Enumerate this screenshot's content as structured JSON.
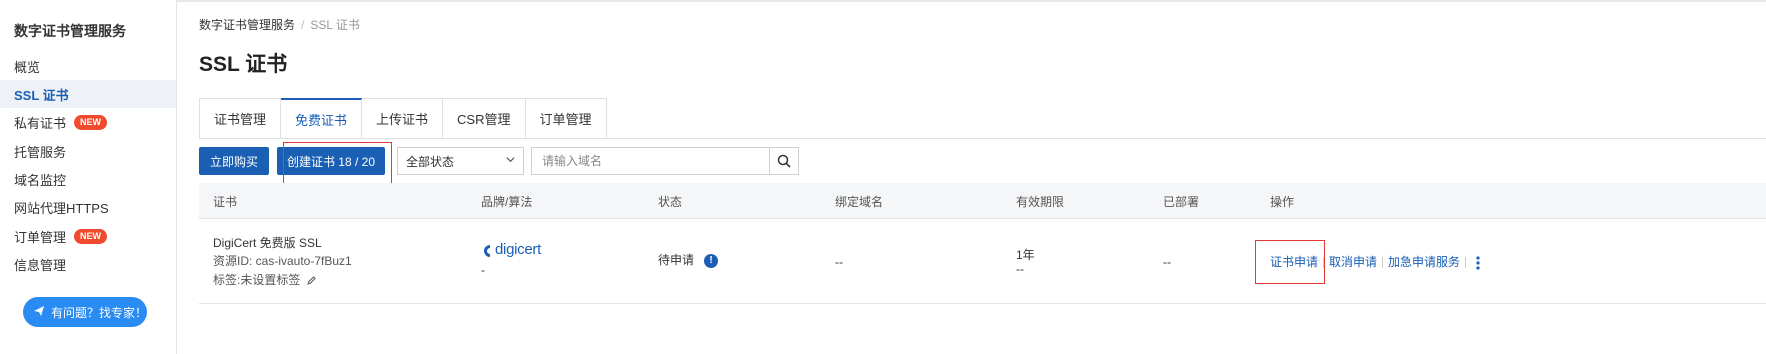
{
  "sidebar": {
    "title": "数字证书管理服务",
    "items": [
      {
        "label": "概览"
      },
      {
        "label": "SSL 证书",
        "active": true
      },
      {
        "label": "私有证书",
        "badge": "NEW"
      },
      {
        "label": "托管服务"
      },
      {
        "label": "域名监控"
      },
      {
        "label": "网站代理HTTPS"
      },
      {
        "label": "订单管理",
        "badge": "NEW"
      },
      {
        "label": "信息管理"
      }
    ],
    "help_button": "有问题？找专家！"
  },
  "breadcrumb": {
    "root": "数字证书管理服务",
    "separator": "/",
    "current": "SSL 证书"
  },
  "page_title": "SSL 证书",
  "tabs": [
    {
      "label": "证书管理"
    },
    {
      "label": "免费证书",
      "active": true
    },
    {
      "label": "上传证书"
    },
    {
      "label": "CSR管理"
    },
    {
      "label": "订单管理"
    }
  ],
  "toolbar": {
    "buy_label": "立即购买",
    "create_label": "创建证书 18 / 20",
    "status_select": "全部状态",
    "search_placeholder": "请输入域名"
  },
  "table": {
    "headers": [
      "证书",
      "品牌/算法",
      "状态",
      "绑定域名",
      "有效期限",
      "已部署",
      "操作"
    ],
    "rows": [
      {
        "cert_name": "DigiCert 免费版 SSL",
        "resource_id": "资源ID: cas-ivauto-7fBuz1",
        "tag": "标签:未设置标签",
        "brand_logo": "digicert",
        "algorithm": "-",
        "status": "待申请",
        "domain": "--",
        "validity": "1年",
        "validity_sub": "--",
        "deployed": "--",
        "ops": [
          "证书申请",
          "取消申请",
          "加急申请服务"
        ]
      }
    ]
  },
  "colors": {
    "accent": "#1a5fb4",
    "badge": "#f04b2e",
    "highlight_box": "#e53935"
  }
}
